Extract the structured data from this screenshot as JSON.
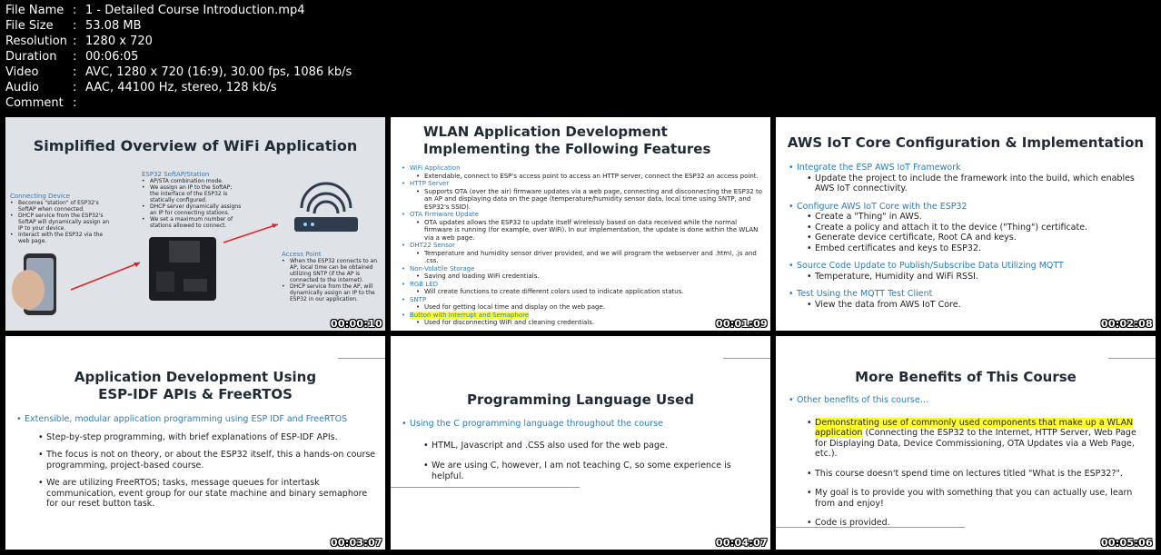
{
  "meta": [
    {
      "key": "File Name",
      "value": "1 - Detailed Course Introduction.mp4"
    },
    {
      "key": "File Size",
      "value": "53.08 MB"
    },
    {
      "key": "Resolution",
      "value": "1280 x 720"
    },
    {
      "key": "Duration",
      "value": "00:06:05"
    },
    {
      "key": "Video",
      "value": "AVC, 1280 x 720 (16:9), 30.00 fps, 1086 kb/s"
    },
    {
      "key": "Audio",
      "value": "AAC, 44100 Hz, stereo, 128 kb/s"
    },
    {
      "key": "Comment",
      "value": ""
    }
  ],
  "separator": ":",
  "thumbs": {
    "t1": {
      "time": "00:00:10",
      "title": "Simplified Overview of WiFi Application",
      "connecting_head": "Connecting Device",
      "connecting_items": [
        "Becomes \"station\" of ESP32's SoftAP when connected.",
        "DHCP service from the ESP32's SoftAP will dynamically assign an IP to your device.",
        "Interact with the ESP32 via the web page."
      ],
      "softap_head": "ESP32 SoftAP/Station",
      "softap_items": [
        "AP/STA combination mode.",
        "We assign an IP to the SoftAP; the interface of the ESP32 is statically configured.",
        "DHCP server dynamically assigns an IP for connecting stations.",
        "We set a maximum number of stations allowed to connect."
      ],
      "ap_head": "Access Point",
      "ap_items": [
        "When the ESP32 connects to an AP, local time can be obtained utilizing SNTP (if the AP is connected to the internet).",
        "DHCP service from the AP, will dynamically assign an IP to the ESP32 in our application."
      ]
    },
    "t2": {
      "time": "00:01:09",
      "title1": "WLAN Application Development",
      "title2": "Implementing the Following Features",
      "items": [
        {
          "head": "WiFi Application",
          "sub": "Extendable, connect to ESP's access point to access an HTTP server, connect the ESP32 an access point."
        },
        {
          "head": "HTTP Server",
          "sub": "Supports OTA (over the air) firmware updates via a web page, connecting and disconnecting the ESP32 to an AP and displaying data on the page (temperature/humidity sensor data, local time using SNTP, and ESP32's SSID)."
        },
        {
          "head": "OTA Firmware Update",
          "sub": "OTA updates allows the ESP32 to update itself wirelessly based on data received while the normal firmware is running (for example, over WiFi). In our implementation, the update is done within the WLAN via a web page."
        },
        {
          "head": "DHT22 Sensor",
          "sub": "Temperature and humidity sensor driver provided, and we will program the webserver and .html, .js and .css."
        },
        {
          "head": "Non-Volatile Storage",
          "sub": "Saving and loading WiFi credentials."
        },
        {
          "head": "RGB LED",
          "sub": "Will create functions to create different colors used to indicate application status."
        },
        {
          "head": "SNTP",
          "sub": "Used for getting local time and display on the web page."
        },
        {
          "head": "Button with Interrupt and Semaphore",
          "sub": "Used for disconnecting WiFi and cleaning credentials."
        }
      ]
    },
    "t3": {
      "time": "00:02:08",
      "title": "AWS IoT Core Configuration & Implementation",
      "sections": [
        {
          "head": "Integrate the ESP AWS IoT Framework",
          "subs": [
            "Update the project to include the framework into the build, which enables AWS IoT connectivity."
          ]
        },
        {
          "head": "Configure AWS IoT Core with the ESP32",
          "subs": [
            "Create a \"Thing\" in AWS.",
            "Create a policy and attach it to the device (\"Thing\") certificate.",
            "Generate device certificate, Root CA and keys.",
            "Embed certificates and keys to ESP32."
          ]
        },
        {
          "head": "Source Code Update to Publish/Subscribe Data Utilizing MQTT",
          "subs": [
            "Temperature, Humidity and WiFi RSSI."
          ]
        },
        {
          "head": "Test Using the MQTT Test Client",
          "subs": [
            "View the data from AWS IoT Core."
          ]
        }
      ]
    },
    "t4": {
      "time": "00:03:07",
      "title1": "Application Development Using",
      "title2": "ESP-IDF APIs & FreeRTOS",
      "head": "Extensible, modular application programming using ESP IDF and FreeRTOS",
      "subs": [
        "Step-by-step programming, with brief explanations of ESP-IDF APIs.",
        "The focus is not on theory, or about the ESP32 itself, this a hands-on course programming, project-based course.",
        "We are utilizing FreeRTOS; tasks, message queues for intertask communication, event group for our state machine and binary semaphore for our reset button task."
      ]
    },
    "t5": {
      "time": "00:04:07",
      "title": "Programming Language Used",
      "head": "Using the C programming language throughout the course",
      "subs": [
        "HTML, Javascript and .CSS also used for the web page.",
        "We are using C, however, I am not teaching C, so some experience is helpful."
      ]
    },
    "t6": {
      "time": "00:05:06",
      "title": "More Benefits of This Course",
      "head": "Other benefits of this course…",
      "sub1_hl": "Demonstrating use of commonly used components that make up a WLAN application",
      "sub1_rest": "(Connecting the ESP32 to the Internet, HTTP Server, Web Page for Displaying Data, Device Commissioning, OTA Updates via a Web Page, etc.).",
      "sub2": "This course doesn't spend time on lectures titled \"What is the ESP32?\".",
      "sub3": "My goal is to provide you with something that you can actually use, learn from and enjoy!",
      "sub4": "Code is provided."
    }
  }
}
